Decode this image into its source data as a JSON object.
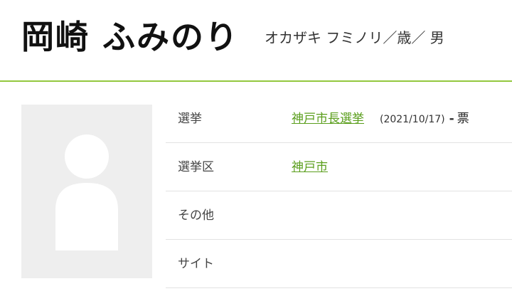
{
  "candidate": {
    "name": "岡崎 ふみのり",
    "kana": "オカザキ フミノリ／歳／ 男"
  },
  "icons": {
    "avatar": "person-placeholder-icon"
  },
  "colors": {
    "accent": "#93c83e",
    "link": "#5a9e1c",
    "avatar_bg": "#eeeeee"
  },
  "rows": {
    "election": {
      "label": "選挙",
      "link": "神戸市長選挙",
      "date": "(2021/10/17)",
      "separator": "-",
      "votes_unit": "票"
    },
    "district": {
      "label": "選挙区",
      "link": "神戸市"
    },
    "other": {
      "label": "その他"
    },
    "site": {
      "label": "サイト"
    }
  }
}
